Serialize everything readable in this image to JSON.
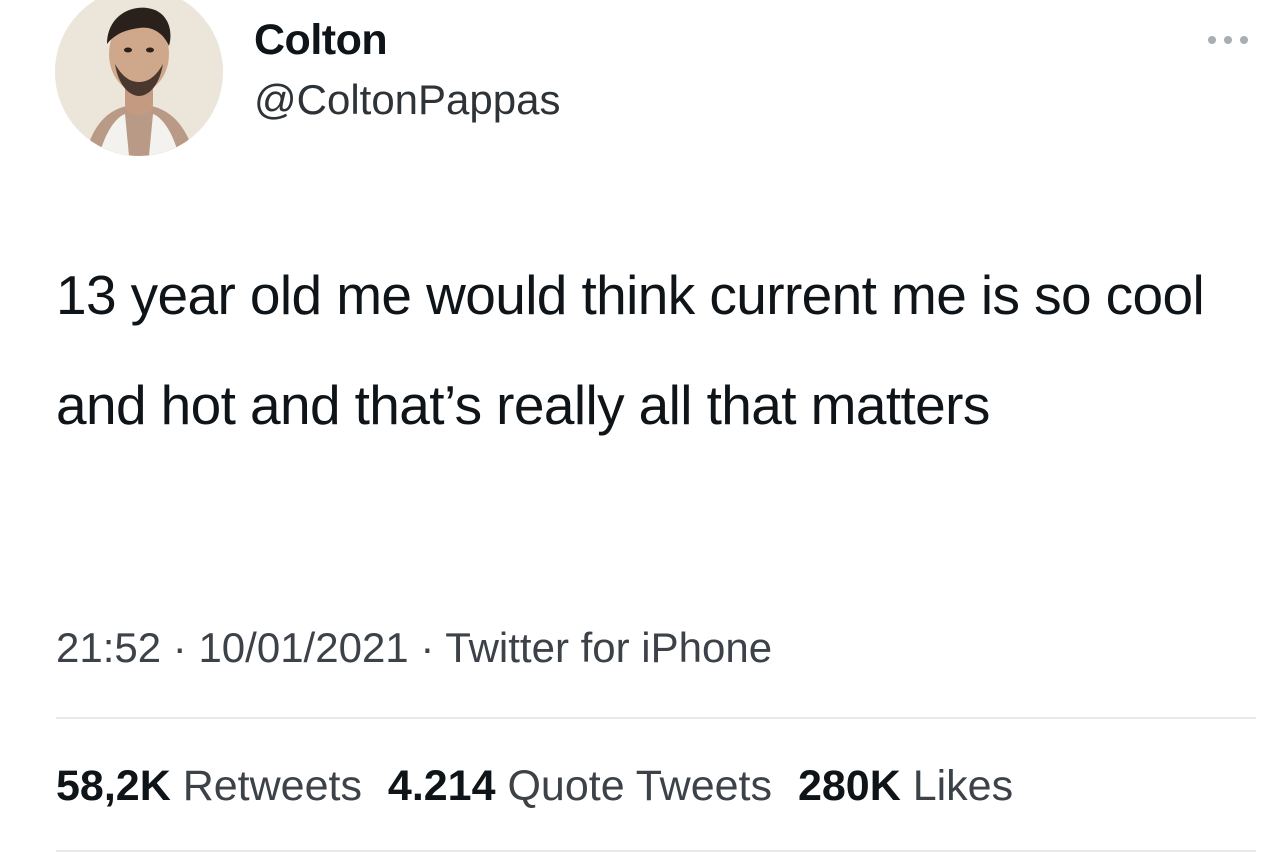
{
  "author": {
    "display_name": "Colton",
    "handle": "@ColtonPappas",
    "avatar_icon": "profile-photo"
  },
  "menu_icon": "more-horizontal-icon",
  "tweet": {
    "text": "13 year old me would think current me is so cool and hot and that’s really all that matters",
    "time": "21:52",
    "separator": "·",
    "date": "10/01/2021",
    "source": "Twitter for iPhone"
  },
  "stats": {
    "retweets_count": "58,2K",
    "retweets_label": "Retweets",
    "quotes_count": "4.214",
    "quotes_label": "Quote Tweets",
    "likes_count": "280K",
    "likes_label": "Likes"
  },
  "colors": {
    "text": "#0f1419",
    "secondary": "#3c4248",
    "divider": "#e6e8ea"
  }
}
